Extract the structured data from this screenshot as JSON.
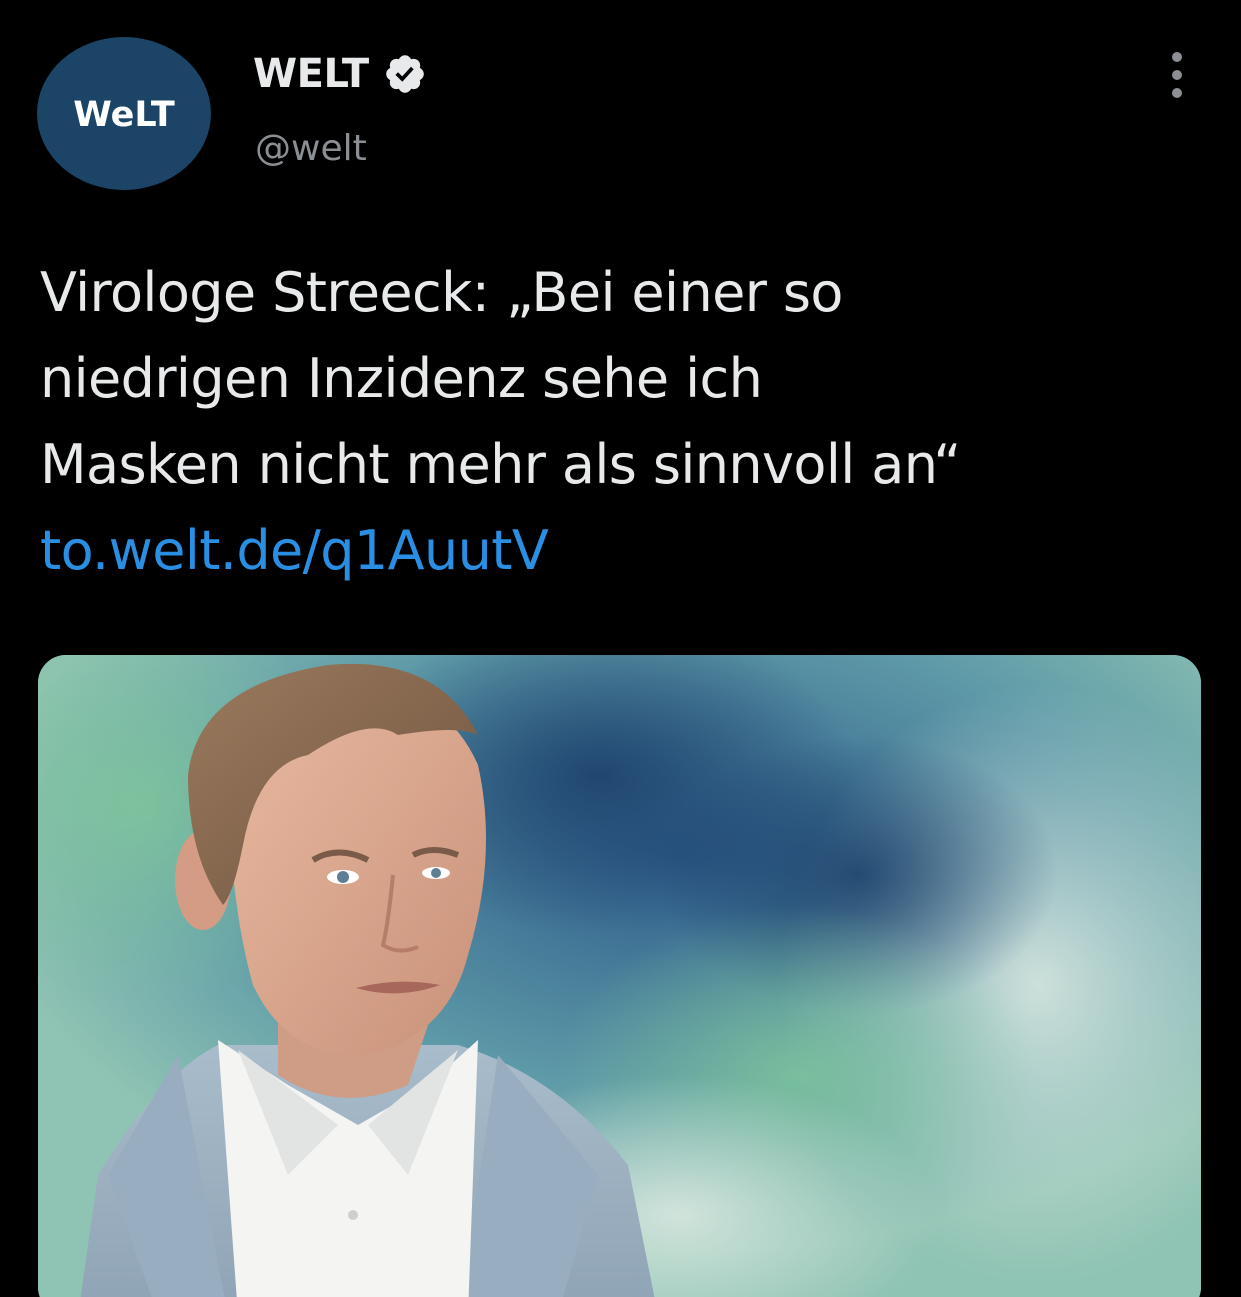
{
  "account": {
    "display_name": "WELT",
    "handle": "@welt",
    "avatar_logo_text": "WeLT",
    "verified": true
  },
  "tweet": {
    "text_lines": [
      "Virologe Streeck: „Bei einer so",
      "niedrigen Inzidenz sehe ich",
      "Masken nicht mehr als sinnvoll an“"
    ],
    "link": "to.welt.de/q1AuutV"
  },
  "icons": {
    "verified": "verified-badge-icon",
    "more": "more-options-icon"
  },
  "colors": {
    "background": "#000000",
    "text": "#e7e9ea",
    "secondary_text": "#8b8f94",
    "link": "#2a8fe3",
    "avatar": "#1b4466"
  }
}
